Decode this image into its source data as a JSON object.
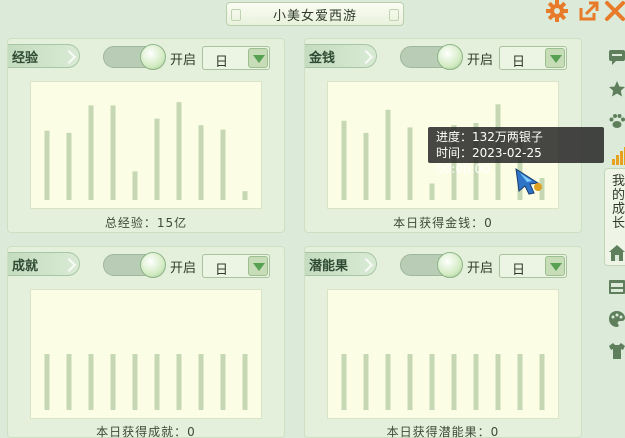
{
  "window": {
    "title": "小美女爱西游",
    "icons": [
      "gear-icon",
      "export-icon",
      "close-icon"
    ],
    "accent": "#e87b2a"
  },
  "panels": [
    {
      "id": "experience",
      "tab_label": "经验",
      "toggle_label": "开启",
      "toggle_on": true,
      "period": "日",
      "footer": "总经验：15亿",
      "bars": [
        0.63,
        0.61,
        0.86,
        0.86,
        0.26,
        0.74,
        0.89,
        0.68,
        0.64,
        0.08
      ]
    },
    {
      "id": "money",
      "tab_label": "金钱",
      "toggle_label": "开启",
      "toggle_on": true,
      "period": "日",
      "footer": "本日获得金钱：0",
      "bars": [
        0.72,
        0.61,
        0.82,
        0.66,
        0.15,
        0.68,
        0.7,
        0.87,
        0.63,
        0.2
      ]
    },
    {
      "id": "achievement",
      "tab_label": "成就",
      "toggle_label": "开启",
      "toggle_on": true,
      "period": "日",
      "footer": "本日获得成就：0",
      "bars": [
        0.5,
        0.5,
        0.5,
        0.5,
        0.5,
        0.5,
        0.5,
        0.5,
        0.5,
        0.5
      ]
    },
    {
      "id": "potential",
      "tab_label": "潜能果",
      "toggle_label": "开启",
      "toggle_on": true,
      "period": "日",
      "footer": "本日获得潜能果：0",
      "bars": [
        0.5,
        0.5,
        0.5,
        0.5,
        0.5,
        0.5,
        0.5,
        0.5,
        0.5,
        0.5
      ]
    }
  ],
  "tooltip": {
    "progress": "进度：132万两银子",
    "time": "时间：2023-02-25 00:00:00"
  },
  "right_bar": {
    "growth_label": "我的成长",
    "icons": [
      "chat-icon",
      "star-icon",
      "paw-icon",
      "signal-bars-icon",
      "house-icon",
      "cabinet-icon",
      "palette-icon",
      "shirt-icon"
    ]
  },
  "colors": {
    "bar": "#c6d7b3",
    "chart_bg": "#fbfde4",
    "panel_bg": "#e5f0dc"
  }
}
